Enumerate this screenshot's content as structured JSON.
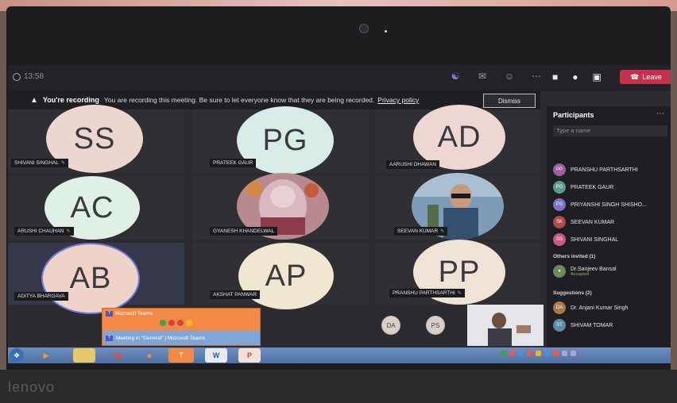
{
  "meeting": {
    "timer": "13:58",
    "leave_label": "Leave"
  },
  "recording_banner": {
    "title": "You're recording",
    "message": "You are recording this meeting. Be sure to let everyone know that they are being recorded.",
    "privacy_link": "Privacy policy",
    "dismiss_label": "Dismiss"
  },
  "tiles": [
    {
      "initials": "SS",
      "name": "SHIVANI SINGHAL",
      "color": "#ecd6d0"
    },
    {
      "initials": "PG",
      "name": "PRATEEK GAUR",
      "color": "#d7ece6"
    },
    {
      "initials": "AD",
      "name": "AARUSHI DHAWAN",
      "color": "#eed6d3"
    },
    {
      "initials": "AC",
      "name": "ARUSHI CHAUHAN",
      "color": "#dff0e4"
    },
    {
      "initials": "",
      "name": "GYANESH KHANDELWAL",
      "color": "#caa0a8"
    },
    {
      "initials": "",
      "name": "SEEVAN KUMAR",
      "color": "#8aa7c4"
    },
    {
      "initials": "AB",
      "name": "ADITYA BHARGAVA",
      "color": "#efd2c8"
    },
    {
      "initials": "AP",
      "name": "AKSHAT PANWAR",
      "color": "#efe7cf"
    },
    {
      "initials": "PP",
      "name": "PRANSHU PARTHSARTHI",
      "color": "#efe3d5"
    }
  ],
  "participants": {
    "title": "Participants",
    "search_placeholder": "Type a name",
    "list": [
      {
        "initials": "PP",
        "name": "PRANSHU PARTHSARTHI",
        "color": "#9b5fa0"
      },
      {
        "initials": "PG",
        "name": "PRATEEK GAUR",
        "color": "#5c9c8c"
      },
      {
        "initials": "PS",
        "name": "PRIYANSHI SINGH SHISHO...",
        "color": "#7a74c8"
      },
      {
        "initials": "SK",
        "name": "SEEVAN KUMAR",
        "color": "#b04a4a"
      },
      {
        "initials": "SS",
        "name": "SHIVANI SINGHAL",
        "color": "#c45a8a"
      }
    ],
    "others_label": "Others invited (1)",
    "invited": {
      "name": "Dr.Sanjeev Bansal",
      "status": "Accepted"
    },
    "suggestions_label": "Suggestions (2)",
    "suggestions": [
      {
        "initials": "DA",
        "name": "Dr. Anjani Kumar Singh",
        "color": "#a87a4a"
      },
      {
        "initials": "ST",
        "name": "SHIVAM TOMAR",
        "color": "#5b8ca8"
      }
    ]
  },
  "overflow_avatars": [
    "DA",
    "PS"
  ],
  "popup": {
    "title": "Microsoft Teams",
    "window_label": "Meeting in \"General\" | Microsoft Teams"
  },
  "taskbar": {
    "word_label": "W",
    "ppt_label": "P"
  },
  "brand": "lenovo"
}
